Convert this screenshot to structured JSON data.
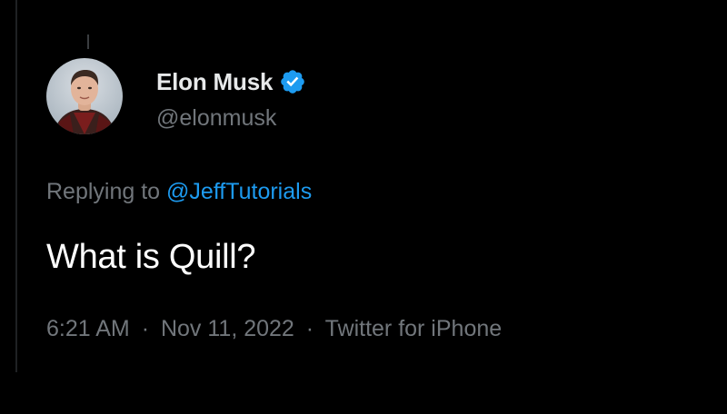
{
  "tweet": {
    "author": {
      "display_name": "Elon Musk",
      "handle": "@elonmusk",
      "verified_icon": "verified-badge-icon",
      "avatar": "avatar-photo"
    },
    "reply": {
      "prefix": "Replying to",
      "mention": "@JeffTutorials"
    },
    "text": "What is Quill?",
    "meta": {
      "time": "6:21 AM",
      "separator": "·",
      "date": "Nov 11, 2022",
      "source": "Twitter for iPhone"
    }
  },
  "colors": {
    "background": "#000000",
    "primary_text": "#e7e9ea",
    "secondary_text": "#71767b",
    "link": "#1d9bf0",
    "verified": "#1d9bf0"
  }
}
